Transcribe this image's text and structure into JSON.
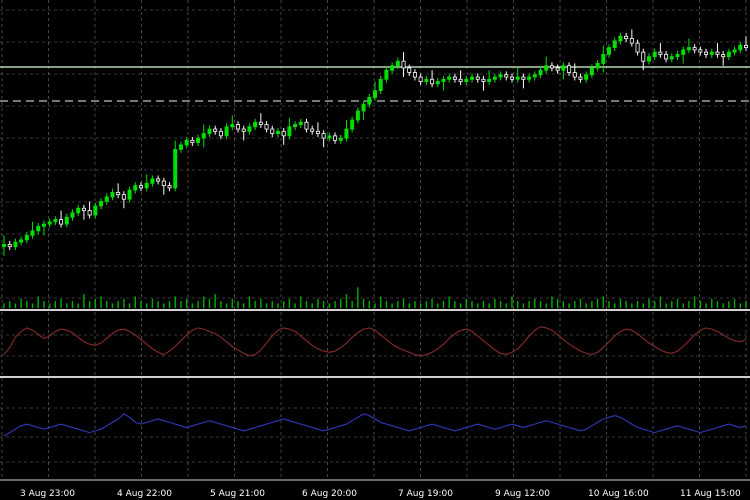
{
  "chart_data": {
    "type": "candlestick",
    "colors": {
      "background": "#000000",
      "grid": "#9a9a9a",
      "candle_up": "#00e000",
      "candle_down": "#ffffff",
      "volume": "#00b000",
      "oscillator_1": "#8a2a2a",
      "oscillator_2": "#2e3ab8",
      "price_level": "#d8ffd8",
      "dashed_level": "#bfbfbf",
      "separator": "#d0d0d0",
      "axis_text": "#ffffff"
    },
    "grid": true,
    "x_labels": [
      "3 Aug 23:00",
      "4 Aug 22:00",
      "5 Aug 21:00",
      "6 Aug 20:00",
      "7 Aug 19:00",
      "9 Aug 12:00",
      "10 Aug 16:00",
      "11 Aug 15:00"
    ],
    "price_close": [
      31,
      30,
      32,
      33,
      35,
      37,
      39,
      40,
      41,
      42,
      40,
      43,
      45,
      47,
      46,
      44,
      48,
      50,
      52,
      54,
      53,
      51,
      55,
      57,
      56,
      58,
      60,
      59,
      57,
      56,
      73,
      75,
      77,
      76,
      78,
      80,
      82,
      81,
      79,
      83,
      84,
      82,
      81,
      83,
      85,
      84,
      82,
      80,
      81,
      79,
      83,
      84,
      85,
      82,
      81,
      80,
      78,
      79,
      77,
      78,
      82,
      86,
      90,
      93,
      96,
      99,
      104,
      108,
      110,
      112,
      109,
      107,
      105,
      103,
      104,
      102,
      103,
      104,
      105,
      104,
      103,
      104,
      105,
      104,
      103,
      104,
      105,
      106,
      105,
      104,
      105,
      104,
      105,
      106,
      108,
      110,
      109,
      108,
      110,
      107,
      105,
      104,
      106,
      109,
      111,
      115,
      118,
      121,
      123,
      122,
      120,
      116,
      112,
      114,
      116,
      115,
      113,
      114,
      115,
      117,
      118,
      117,
      116,
      115,
      116,
      115,
      114,
      116,
      117,
      119,
      118
    ],
    "volume": [
      2,
      3,
      2,
      4,
      3,
      2,
      5,
      3,
      2,
      3,
      4,
      2,
      3,
      2,
      6,
      3,
      4,
      5,
      3,
      2,
      3,
      4,
      2,
      5,
      3,
      2,
      4,
      3,
      2,
      3,
      5,
      3,
      4,
      2,
      3,
      5,
      4,
      6,
      3,
      2,
      4,
      3,
      2,
      5,
      3,
      4,
      2,
      3,
      2,
      3,
      4,
      2,
      5,
      3,
      2,
      4,
      3,
      2,
      3,
      4,
      6,
      3,
      9,
      4,
      3,
      2,
      5,
      3,
      2,
      3,
      4,
      2,
      3,
      2,
      3,
      4,
      2,
      3,
      5,
      3,
      2,
      4,
      3,
      2,
      3,
      2,
      4,
      3,
      2,
      5,
      3,
      2,
      3,
      4,
      3,
      2,
      5,
      4,
      3,
      2,
      3,
      4,
      2,
      3,
      4,
      5,
      3,
      2,
      4,
      3,
      2,
      3,
      2,
      4,
      3,
      5,
      2,
      3,
      4,
      2,
      3,
      5,
      3,
      2,
      4,
      3,
      2,
      3,
      4,
      2,
      3
    ],
    "oscillator_1": [
      30,
      42,
      60,
      70,
      76,
      72,
      65,
      58,
      62,
      70,
      74,
      72,
      68,
      60,
      52,
      48,
      46,
      50,
      58,
      66,
      72,
      74,
      70,
      64,
      56,
      48,
      40,
      34,
      30,
      36,
      44,
      54,
      64,
      72,
      76,
      74,
      70,
      66,
      60,
      52,
      44,
      38,
      32,
      28,
      30,
      38,
      50,
      62,
      72,
      76,
      74,
      70,
      62,
      54,
      46,
      40,
      36,
      34,
      36,
      42,
      50,
      60,
      68,
      74,
      76,
      72,
      64,
      56,
      48,
      42,
      38,
      34,
      30,
      28,
      30,
      34,
      40,
      48,
      58,
      66,
      72,
      74,
      70,
      62,
      54,
      46,
      38,
      32,
      30,
      34,
      40,
      50,
      62,
      72,
      78,
      76,
      72,
      64,
      56,
      48,
      42,
      36,
      32,
      30,
      34,
      42,
      52,
      62,
      70,
      74,
      72,
      66,
      58,
      50,
      44,
      38,
      34,
      32,
      36,
      44,
      54,
      64,
      72,
      76,
      74,
      70,
      64,
      58,
      54,
      52,
      56
    ],
    "oscillator_2": [
      40,
      44,
      48,
      52,
      54,
      52,
      50,
      48,
      50,
      52,
      54,
      52,
      50,
      48,
      46,
      44,
      46,
      48,
      52,
      56,
      60,
      66,
      62,
      56,
      54,
      56,
      58,
      60,
      58,
      56,
      54,
      52,
      50,
      52,
      54,
      56,
      58,
      56,
      54,
      52,
      50,
      48,
      46,
      48,
      50,
      52,
      54,
      56,
      58,
      60,
      58,
      56,
      54,
      52,
      50,
      48,
      46,
      48,
      50,
      52,
      54,
      58,
      62,
      66,
      64,
      60,
      56,
      54,
      52,
      50,
      48,
      46,
      48,
      50,
      52,
      54,
      52,
      50,
      48,
      46,
      48,
      50,
      52,
      54,
      52,
      50,
      48,
      50,
      52,
      54,
      52,
      50,
      52,
      54,
      56,
      58,
      56,
      54,
      52,
      50,
      48,
      46,
      48,
      52,
      56,
      60,
      62,
      64,
      62,
      58,
      54,
      50,
      48,
      46,
      44,
      46,
      48,
      50,
      52,
      50,
      48,
      46,
      44,
      46,
      48,
      50,
      52,
      54,
      52,
      50,
      52
    ]
  }
}
